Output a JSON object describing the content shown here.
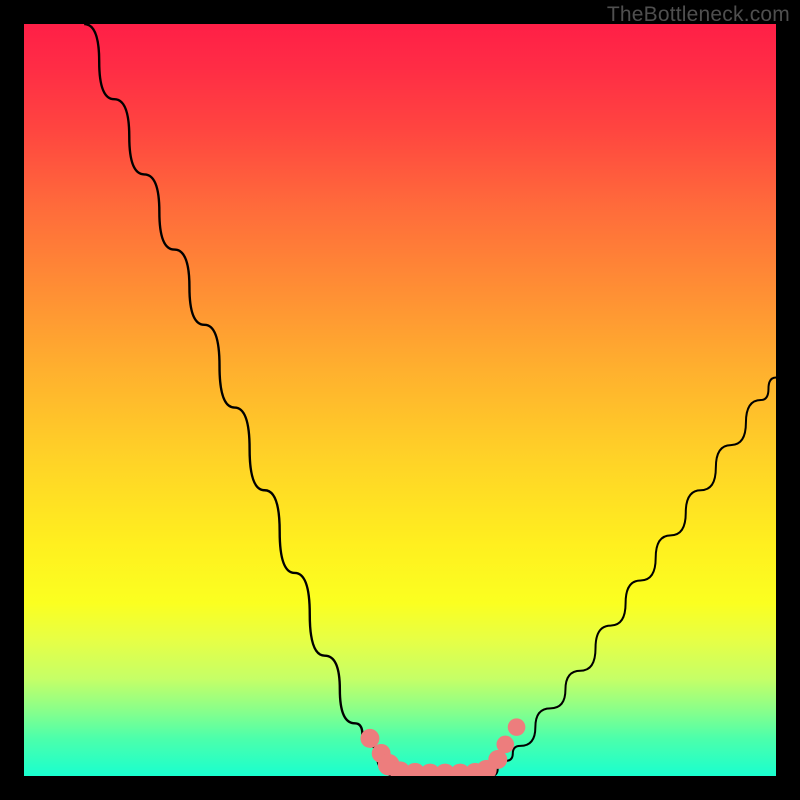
{
  "watermark": "TheBottleneck.com",
  "colors": {
    "frame": "#000000",
    "curve": "#000000",
    "marker_fill": "#ed7d7d",
    "marker_stroke": "#e56b6b",
    "gradient_top": "#ff1f47",
    "gradient_bottom": "#19ffcf"
  },
  "chart_data": {
    "type": "line",
    "title": "",
    "xlabel": "",
    "ylabel": "",
    "xlim": [
      0,
      100
    ],
    "ylim": [
      0,
      100
    ],
    "series": [
      {
        "name": "left-branch",
        "x": [
          8,
          12,
          16,
          20,
          24,
          28,
          32,
          36,
          40,
          44,
          46,
          48,
          49
        ],
        "y": [
          100,
          90,
          80,
          70,
          60,
          49,
          38,
          27,
          16,
          7,
          4,
          1,
          0
        ]
      },
      {
        "name": "right-branch",
        "x": [
          62,
          64,
          66,
          70,
          74,
          78,
          82,
          86,
          90,
          94,
          98,
          100
        ],
        "y": [
          0,
          2,
          4,
          9,
          14,
          20,
          26,
          32,
          38,
          44,
          50,
          53
        ]
      }
    ],
    "markers": [
      {
        "x": 46,
        "y": 5,
        "r": 1.4
      },
      {
        "x": 47.5,
        "y": 3,
        "r": 1.4
      },
      {
        "x": 48.5,
        "y": 1.5,
        "r": 1.6
      },
      {
        "x": 50,
        "y": 0.6,
        "r": 1.5
      },
      {
        "x": 52,
        "y": 0.4,
        "r": 1.5
      },
      {
        "x": 54,
        "y": 0.3,
        "r": 1.5
      },
      {
        "x": 56,
        "y": 0.3,
        "r": 1.5
      },
      {
        "x": 58,
        "y": 0.3,
        "r": 1.5
      },
      {
        "x": 60,
        "y": 0.4,
        "r": 1.5
      },
      {
        "x": 61.5,
        "y": 0.8,
        "r": 1.5
      },
      {
        "x": 63,
        "y": 2.2,
        "r": 1.4
      },
      {
        "x": 64,
        "y": 4.2,
        "r": 1.3
      },
      {
        "x": 65.5,
        "y": 6.5,
        "r": 1.3
      }
    ],
    "grid": false,
    "legend": false
  }
}
